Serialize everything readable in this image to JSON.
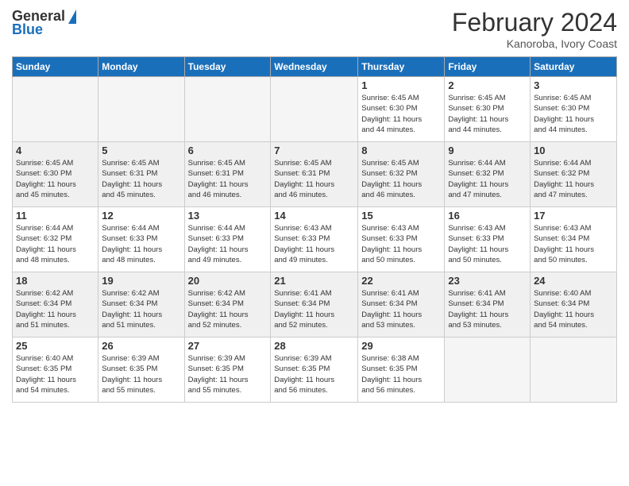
{
  "logo": {
    "general": "General",
    "blue": "Blue"
  },
  "title": {
    "month_year": "February 2024",
    "location": "Kanoroba, Ivory Coast"
  },
  "weekdays": [
    "Sunday",
    "Monday",
    "Tuesday",
    "Wednesday",
    "Thursday",
    "Friday",
    "Saturday"
  ],
  "weeks": [
    {
      "shaded": false,
      "days": [
        {
          "num": "",
          "info": ""
        },
        {
          "num": "",
          "info": ""
        },
        {
          "num": "",
          "info": ""
        },
        {
          "num": "",
          "info": ""
        },
        {
          "num": "1",
          "info": "Sunrise: 6:45 AM\nSunset: 6:30 PM\nDaylight: 11 hours\nand 44 minutes."
        },
        {
          "num": "2",
          "info": "Sunrise: 6:45 AM\nSunset: 6:30 PM\nDaylight: 11 hours\nand 44 minutes."
        },
        {
          "num": "3",
          "info": "Sunrise: 6:45 AM\nSunset: 6:30 PM\nDaylight: 11 hours\nand 44 minutes."
        }
      ]
    },
    {
      "shaded": true,
      "days": [
        {
          "num": "4",
          "info": "Sunrise: 6:45 AM\nSunset: 6:30 PM\nDaylight: 11 hours\nand 45 minutes."
        },
        {
          "num": "5",
          "info": "Sunrise: 6:45 AM\nSunset: 6:31 PM\nDaylight: 11 hours\nand 45 minutes."
        },
        {
          "num": "6",
          "info": "Sunrise: 6:45 AM\nSunset: 6:31 PM\nDaylight: 11 hours\nand 46 minutes."
        },
        {
          "num": "7",
          "info": "Sunrise: 6:45 AM\nSunset: 6:31 PM\nDaylight: 11 hours\nand 46 minutes."
        },
        {
          "num": "8",
          "info": "Sunrise: 6:45 AM\nSunset: 6:32 PM\nDaylight: 11 hours\nand 46 minutes."
        },
        {
          "num": "9",
          "info": "Sunrise: 6:44 AM\nSunset: 6:32 PM\nDaylight: 11 hours\nand 47 minutes."
        },
        {
          "num": "10",
          "info": "Sunrise: 6:44 AM\nSunset: 6:32 PM\nDaylight: 11 hours\nand 47 minutes."
        }
      ]
    },
    {
      "shaded": false,
      "days": [
        {
          "num": "11",
          "info": "Sunrise: 6:44 AM\nSunset: 6:32 PM\nDaylight: 11 hours\nand 48 minutes."
        },
        {
          "num": "12",
          "info": "Sunrise: 6:44 AM\nSunset: 6:33 PM\nDaylight: 11 hours\nand 48 minutes."
        },
        {
          "num": "13",
          "info": "Sunrise: 6:44 AM\nSunset: 6:33 PM\nDaylight: 11 hours\nand 49 minutes."
        },
        {
          "num": "14",
          "info": "Sunrise: 6:43 AM\nSunset: 6:33 PM\nDaylight: 11 hours\nand 49 minutes."
        },
        {
          "num": "15",
          "info": "Sunrise: 6:43 AM\nSunset: 6:33 PM\nDaylight: 11 hours\nand 50 minutes."
        },
        {
          "num": "16",
          "info": "Sunrise: 6:43 AM\nSunset: 6:33 PM\nDaylight: 11 hours\nand 50 minutes."
        },
        {
          "num": "17",
          "info": "Sunrise: 6:43 AM\nSunset: 6:34 PM\nDaylight: 11 hours\nand 50 minutes."
        }
      ]
    },
    {
      "shaded": true,
      "days": [
        {
          "num": "18",
          "info": "Sunrise: 6:42 AM\nSunset: 6:34 PM\nDaylight: 11 hours\nand 51 minutes."
        },
        {
          "num": "19",
          "info": "Sunrise: 6:42 AM\nSunset: 6:34 PM\nDaylight: 11 hours\nand 51 minutes."
        },
        {
          "num": "20",
          "info": "Sunrise: 6:42 AM\nSunset: 6:34 PM\nDaylight: 11 hours\nand 52 minutes."
        },
        {
          "num": "21",
          "info": "Sunrise: 6:41 AM\nSunset: 6:34 PM\nDaylight: 11 hours\nand 52 minutes."
        },
        {
          "num": "22",
          "info": "Sunrise: 6:41 AM\nSunset: 6:34 PM\nDaylight: 11 hours\nand 53 minutes."
        },
        {
          "num": "23",
          "info": "Sunrise: 6:41 AM\nSunset: 6:34 PM\nDaylight: 11 hours\nand 53 minutes."
        },
        {
          "num": "24",
          "info": "Sunrise: 6:40 AM\nSunset: 6:34 PM\nDaylight: 11 hours\nand 54 minutes."
        }
      ]
    },
    {
      "shaded": false,
      "days": [
        {
          "num": "25",
          "info": "Sunrise: 6:40 AM\nSunset: 6:35 PM\nDaylight: 11 hours\nand 54 minutes."
        },
        {
          "num": "26",
          "info": "Sunrise: 6:39 AM\nSunset: 6:35 PM\nDaylight: 11 hours\nand 55 minutes."
        },
        {
          "num": "27",
          "info": "Sunrise: 6:39 AM\nSunset: 6:35 PM\nDaylight: 11 hours\nand 55 minutes."
        },
        {
          "num": "28",
          "info": "Sunrise: 6:39 AM\nSunset: 6:35 PM\nDaylight: 11 hours\nand 56 minutes."
        },
        {
          "num": "29",
          "info": "Sunrise: 6:38 AM\nSunset: 6:35 PM\nDaylight: 11 hours\nand 56 minutes."
        },
        {
          "num": "",
          "info": ""
        },
        {
          "num": "",
          "info": ""
        }
      ]
    }
  ]
}
